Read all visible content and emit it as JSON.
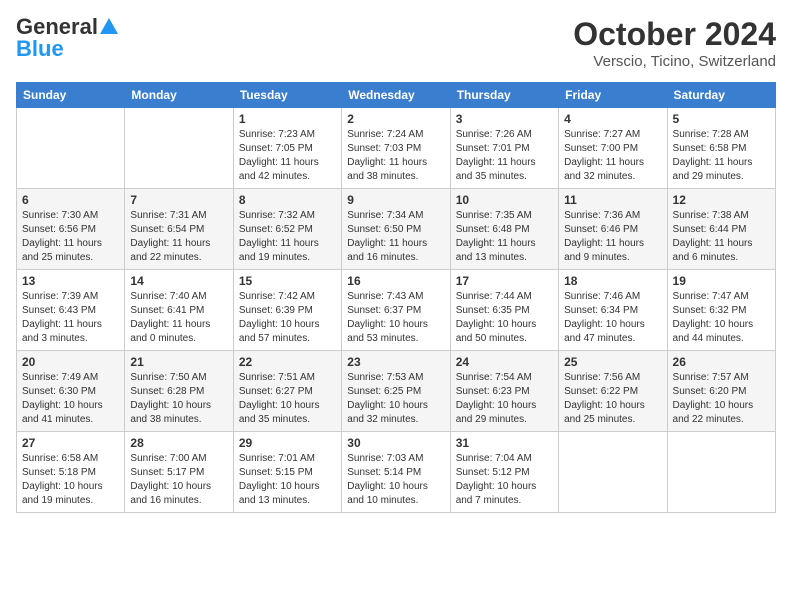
{
  "logo": {
    "general": "General",
    "blue": "Blue"
  },
  "title": "October 2024",
  "location": "Verscio, Ticino, Switzerland",
  "days_of_week": [
    "Sunday",
    "Monday",
    "Tuesday",
    "Wednesday",
    "Thursday",
    "Friday",
    "Saturday"
  ],
  "weeks": [
    [
      {
        "day": "",
        "info": ""
      },
      {
        "day": "",
        "info": ""
      },
      {
        "day": "1",
        "info": "Sunrise: 7:23 AM\nSunset: 7:05 PM\nDaylight: 11 hours and 42 minutes."
      },
      {
        "day": "2",
        "info": "Sunrise: 7:24 AM\nSunset: 7:03 PM\nDaylight: 11 hours and 38 minutes."
      },
      {
        "day": "3",
        "info": "Sunrise: 7:26 AM\nSunset: 7:01 PM\nDaylight: 11 hours and 35 minutes."
      },
      {
        "day": "4",
        "info": "Sunrise: 7:27 AM\nSunset: 7:00 PM\nDaylight: 11 hours and 32 minutes."
      },
      {
        "day": "5",
        "info": "Sunrise: 7:28 AM\nSunset: 6:58 PM\nDaylight: 11 hours and 29 minutes."
      }
    ],
    [
      {
        "day": "6",
        "info": "Sunrise: 7:30 AM\nSunset: 6:56 PM\nDaylight: 11 hours and 25 minutes."
      },
      {
        "day": "7",
        "info": "Sunrise: 7:31 AM\nSunset: 6:54 PM\nDaylight: 11 hours and 22 minutes."
      },
      {
        "day": "8",
        "info": "Sunrise: 7:32 AM\nSunset: 6:52 PM\nDaylight: 11 hours and 19 minutes."
      },
      {
        "day": "9",
        "info": "Sunrise: 7:34 AM\nSunset: 6:50 PM\nDaylight: 11 hours and 16 minutes."
      },
      {
        "day": "10",
        "info": "Sunrise: 7:35 AM\nSunset: 6:48 PM\nDaylight: 11 hours and 13 minutes."
      },
      {
        "day": "11",
        "info": "Sunrise: 7:36 AM\nSunset: 6:46 PM\nDaylight: 11 hours and 9 minutes."
      },
      {
        "day": "12",
        "info": "Sunrise: 7:38 AM\nSunset: 6:44 PM\nDaylight: 11 hours and 6 minutes."
      }
    ],
    [
      {
        "day": "13",
        "info": "Sunrise: 7:39 AM\nSunset: 6:43 PM\nDaylight: 11 hours and 3 minutes."
      },
      {
        "day": "14",
        "info": "Sunrise: 7:40 AM\nSunset: 6:41 PM\nDaylight: 11 hours and 0 minutes."
      },
      {
        "day": "15",
        "info": "Sunrise: 7:42 AM\nSunset: 6:39 PM\nDaylight: 10 hours and 57 minutes."
      },
      {
        "day": "16",
        "info": "Sunrise: 7:43 AM\nSunset: 6:37 PM\nDaylight: 10 hours and 53 minutes."
      },
      {
        "day": "17",
        "info": "Sunrise: 7:44 AM\nSunset: 6:35 PM\nDaylight: 10 hours and 50 minutes."
      },
      {
        "day": "18",
        "info": "Sunrise: 7:46 AM\nSunset: 6:34 PM\nDaylight: 10 hours and 47 minutes."
      },
      {
        "day": "19",
        "info": "Sunrise: 7:47 AM\nSunset: 6:32 PM\nDaylight: 10 hours and 44 minutes."
      }
    ],
    [
      {
        "day": "20",
        "info": "Sunrise: 7:49 AM\nSunset: 6:30 PM\nDaylight: 10 hours and 41 minutes."
      },
      {
        "day": "21",
        "info": "Sunrise: 7:50 AM\nSunset: 6:28 PM\nDaylight: 10 hours and 38 minutes."
      },
      {
        "day": "22",
        "info": "Sunrise: 7:51 AM\nSunset: 6:27 PM\nDaylight: 10 hours and 35 minutes."
      },
      {
        "day": "23",
        "info": "Sunrise: 7:53 AM\nSunset: 6:25 PM\nDaylight: 10 hours and 32 minutes."
      },
      {
        "day": "24",
        "info": "Sunrise: 7:54 AM\nSunset: 6:23 PM\nDaylight: 10 hours and 29 minutes."
      },
      {
        "day": "25",
        "info": "Sunrise: 7:56 AM\nSunset: 6:22 PM\nDaylight: 10 hours and 25 minutes."
      },
      {
        "day": "26",
        "info": "Sunrise: 7:57 AM\nSunset: 6:20 PM\nDaylight: 10 hours and 22 minutes."
      }
    ],
    [
      {
        "day": "27",
        "info": "Sunrise: 6:58 AM\nSunset: 5:18 PM\nDaylight: 10 hours and 19 minutes."
      },
      {
        "day": "28",
        "info": "Sunrise: 7:00 AM\nSunset: 5:17 PM\nDaylight: 10 hours and 16 minutes."
      },
      {
        "day": "29",
        "info": "Sunrise: 7:01 AM\nSunset: 5:15 PM\nDaylight: 10 hours and 13 minutes."
      },
      {
        "day": "30",
        "info": "Sunrise: 7:03 AM\nSunset: 5:14 PM\nDaylight: 10 hours and 10 minutes."
      },
      {
        "day": "31",
        "info": "Sunrise: 7:04 AM\nSunset: 5:12 PM\nDaylight: 10 hours and 7 minutes."
      },
      {
        "day": "",
        "info": ""
      },
      {
        "day": "",
        "info": ""
      }
    ]
  ]
}
